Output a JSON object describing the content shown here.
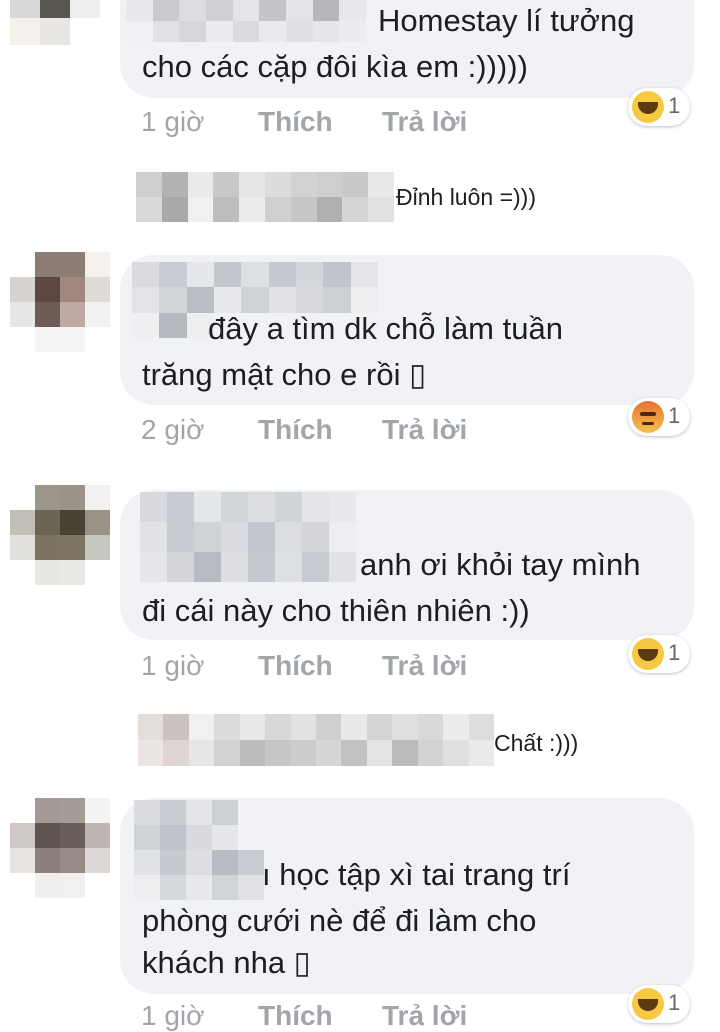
{
  "comments": [
    {
      "lines": [
        "Homestay lí tưởng",
        "cho các cặp đôi kìa em :)))))"
      ],
      "time": "1 giờ",
      "like": "Thích",
      "reply": "Trả lời",
      "reaction": {
        "icon": "haha-reaction-icon",
        "count": "1"
      }
    },
    {
      "reply_text": "Đỉnh luôn =)))"
    },
    {
      "lines": [
        "đây a tìm dk chỗ làm tuần",
        "trăng mật cho e rồi ▯"
      ],
      "time": "2 giờ",
      "like": "Thích",
      "reply": "Trả lời",
      "reaction": {
        "icon": "angry-reaction-icon",
        "count": "1"
      }
    },
    {
      "lines": [
        "anh ơi khỏi tay mình",
        "đi cái này cho thiên nhiên :))"
      ],
      "time": "1 giờ",
      "like": "Thích",
      "reply": "Trả lời",
      "reaction": {
        "icon": "haha-reaction-icon",
        "count": "1"
      }
    },
    {
      "reply_text": "Chất :)))"
    },
    {
      "lines": [
        "ı học tập xì tai trang trí",
        "phòng cưới nè để đi làm cho",
        "khách nha ▯"
      ],
      "time": "1 giờ",
      "like": "Thích",
      "reply": "Trả lời",
      "reaction": {
        "icon": "haha-reaction-icon",
        "count": "1"
      }
    }
  ],
  "colors": {
    "bubble": "#f0f2f5",
    "meta_text": "#a2a6ab",
    "haha": "#f7c942",
    "angry": "#e9712f"
  }
}
